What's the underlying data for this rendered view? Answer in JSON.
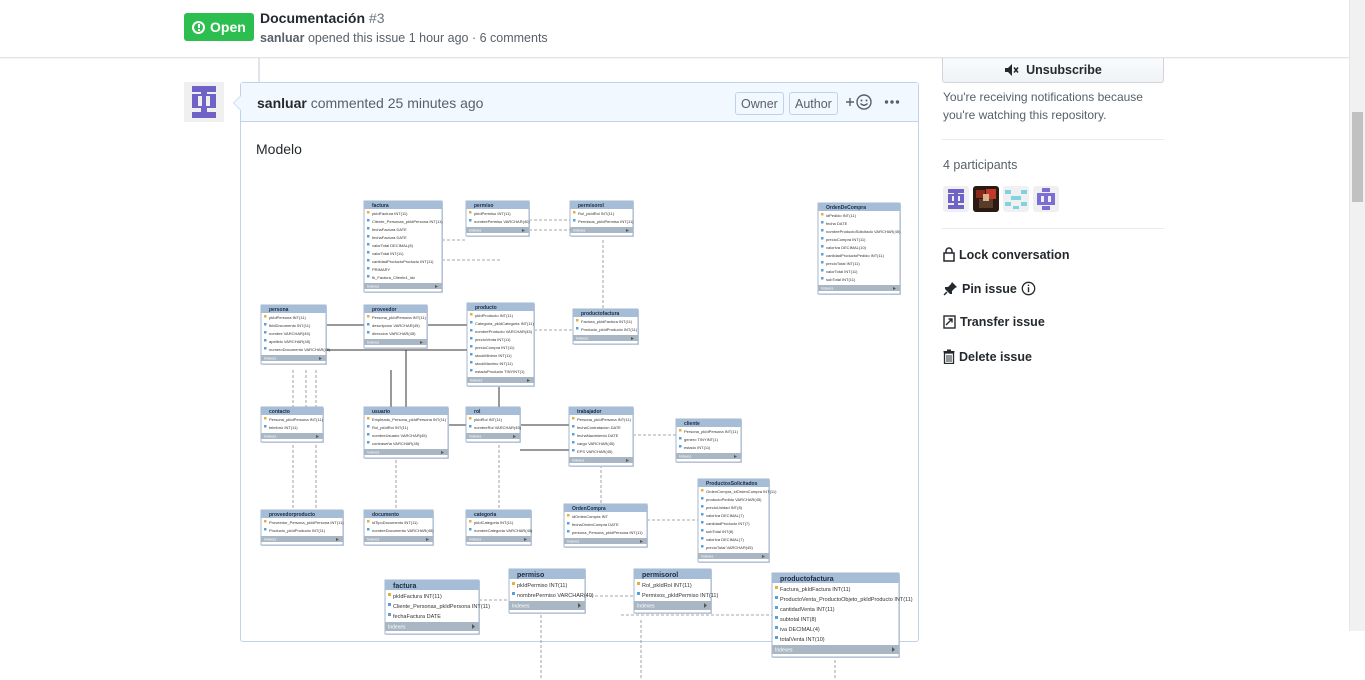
{
  "header": {
    "state": "Open",
    "title": "Documentación",
    "number": "#3",
    "author": "sanluar",
    "meta_rest": "opened this issue 1 hour ago · 6 comments"
  },
  "comment": {
    "author": "sanluar",
    "action": "commented 25 minutes ago",
    "labels": [
      "Owner",
      "Author"
    ],
    "body": "Modelo"
  },
  "sidebar": {
    "unsubscribe_label": "Unsubscribe",
    "notification_text": "You're receiving notifications because you're watching this repository.",
    "participants_label": "4 participants",
    "actions": [
      "Lock conversation",
      "Pin issue",
      "Transfer issue",
      "Delete issue"
    ]
  },
  "diagram": {
    "tables": [
      {
        "name": "factura",
        "rows": [
          "pkIdFactura INT(11)",
          "Cliente_Personas_pkIdPersona INT(11)",
          "fechaFactura DATE",
          "fechaFactura DATE",
          "valorTotal DECIMAL(8)",
          "valorTotal INT(11)",
          "cantidadProductoProducto INT(11)",
          "PRIMARY",
          "fk_Factura_Cliente1_idx"
        ]
      },
      {
        "name": "permiso",
        "rows": [
          "pkIdPermiso INT(11)",
          "nombrePermiso VARCHAR(40)"
        ]
      },
      {
        "name": "permisorol",
        "rows": [
          "Rol_pkIdRol INT(11)",
          "Permisos_pkIdPermiso INT(11)"
        ]
      },
      {
        "name": "OrdenDeCompra",
        "rows": [
          "idPedido INT(11)",
          "fecha DATE",
          "nombreProductoSolicitado VARCHAR(45)",
          "precioCompra INT(11)",
          "valorIva DECIMAL(10)",
          "cantidadProductoPedido INT(11)",
          "precioTotal INT(11)",
          "valorTotal INT(11)",
          "subTotal INT(11)"
        ]
      },
      {
        "name": "persona",
        "rows": [
          "pkIdPersona INT(11)",
          "fkIdDocumento INT(11)",
          "nombre VARCHAR(45)",
          "apellido VARCHAR(45)",
          "numeroDocumento VARCHAR(45)"
        ]
      },
      {
        "name": "proveedor",
        "rows": [
          "Persona_pkIdPersona INT(11)",
          "descripcion VARCHAR(45)",
          "direccion VARCHAR(45)"
        ]
      },
      {
        "name": "producto",
        "rows": [
          "pkIdProducto INT(11)",
          "Categoria_pkIdCategoria INT(11)",
          "nombreProducto VARCHAR(45)",
          "precioVenta INT(11)",
          "precioCompra INT(11)",
          "stockMinimo INT(11)",
          "stockMaximo INT(11)",
          "estadoProducto TINYINT(1)"
        ]
      },
      {
        "name": "productofactura",
        "rows": [
          "Factura_pkIdFactura INT(11)",
          "Producto_pkIdProducto INT(11)"
        ]
      },
      {
        "name": "contacto",
        "rows": [
          "Persona_pkIdPersona INT(11)",
          "telefono INT(11)"
        ]
      },
      {
        "name": "usuario",
        "rows": [
          "Empleado_Persona_pkIdPersona INT(11)",
          "Rol_pkIdRol INT(11)",
          "nombreUsuario VARCHAR(45)",
          "contraseña VARCHAR(45)"
        ]
      },
      {
        "name": "rol",
        "rows": [
          "pkIdRol INT(11)",
          "nombreRol VARCHAR(45)"
        ]
      },
      {
        "name": "trabajador",
        "rows": [
          "Persona_pkIdPersona INT(11)",
          "fechaContratacion DATE",
          "fechaNacimiento DATE",
          "cargo VARCHAR(45)",
          "EPS VARCHAR(45)"
        ]
      },
      {
        "name": "cliente",
        "rows": [
          "Persona_pkIdPersona INT(11)",
          "genero TINYINT(1)",
          "estado INT(11)"
        ]
      },
      {
        "name": "ProductosSolicitados",
        "rows": [
          "OrdenCompra_idOrdenCompra INT(11)",
          "productoPedido VARCHAR(45)",
          "precioUnidad INT(8)",
          "valorIva DECIMAL(7)",
          "cantidadProducto INT(7)",
          "subTotal INT(8)",
          "valorIva DECIMAL(7)",
          "precioTotal VARCHAR(45)"
        ]
      },
      {
        "name": "proveedorproducto",
        "rows": [
          "Proveedor_Persona_pkIdPersona INT(11)",
          "Producto_pkIdProducto INT(11)"
        ]
      },
      {
        "name": "documento",
        "rows": [
          "idTipoDocumento INT(11)",
          "nombreDocumento VARCHAR(45)"
        ]
      },
      {
        "name": "categoria",
        "rows": [
          "pkIdCategoria INT(11)",
          "nombreCategoria VARCHAR(45)"
        ]
      },
      {
        "name": "OrdenCompra",
        "rows": [
          "idOrdenCompra INT",
          "fechaOrdenCompra DATE",
          "persona_Persona_pkIdPersona INT(11)"
        ]
      },
      {
        "name": "factura",
        "rows": [
          "pkIdFactura INT(11)",
          "Cliente_Personas_pkIdPersona INT(11)",
          "fechaFactura DATE"
        ]
      },
      {
        "name": "permiso",
        "rows": [
          "pkIdPermiso INT(11)",
          "nombrePermiso VARCHAR(40)"
        ]
      },
      {
        "name": "permisorol",
        "rows": [
          "Rol_pkIdRol INT(11)",
          "Permisos_pkIdPermiso INT(11)"
        ]
      },
      {
        "name": "productofactura",
        "rows": [
          "Factura_pkIdFactura INT(11)",
          "ProductoVenta_ProductoObjeto_pkIdProducto INT(11)",
          "cantidadVenta INT(11)",
          "subtotal INT(8)",
          "iva DECIMAL(4)",
          "totalVenta INT(10)"
        ]
      }
    ],
    "footer_label": "Indexes"
  }
}
